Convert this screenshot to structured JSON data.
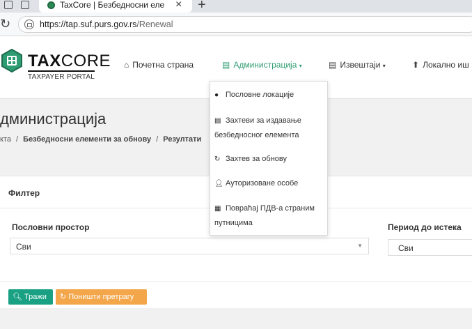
{
  "browser": {
    "tab_title": "TaxCore | Безбедносни елементи",
    "tab_close": "×",
    "new_tab": "+",
    "url_host": "https://tap.suf.purs.gov.rs",
    "url_path": "/Renewal"
  },
  "header": {
    "logo_tax": "TAX",
    "logo_core": "CORE",
    "logo_sub": "TAXPAYER PORTAL",
    "nav": {
      "home": "Почетна страна",
      "admin": "Администрација",
      "reports": "Извештаји",
      "local": "Локално иш"
    }
  },
  "dropdown": {
    "items": [
      {
        "label": "Пословне локације",
        "icon": "compass-icon"
      },
      {
        "label": "Захтеви за издавање безбедносног елемента",
        "icon": "id-card-icon"
      },
      {
        "label": "Захтев за обнову",
        "icon": "refresh-icon"
      },
      {
        "label": "Ауторизоване особе",
        "icon": "user-icon"
      },
      {
        "label": "Повраћај ПДВ-а страним путницима",
        "icon": "calculator-icon"
      }
    ]
  },
  "page": {
    "title": "дминистрација",
    "breadcrumb_start": "кта",
    "breadcrumb_sep": "/",
    "breadcrumb_mid": "Безбедносни елементи за обнову",
    "breadcrumb_end": "Резултати"
  },
  "filter": {
    "heading": "Филтер",
    "business_label": "Пословни простор",
    "business_value": "Сви",
    "period_label": "Период до истека",
    "period_value": "Сви",
    "search_btn": "Тражи",
    "reset_btn": "Поништи претрагу"
  },
  "colors": {
    "accent": "#2e9c72",
    "search": "#1aa184",
    "reset": "#f3a64a"
  }
}
